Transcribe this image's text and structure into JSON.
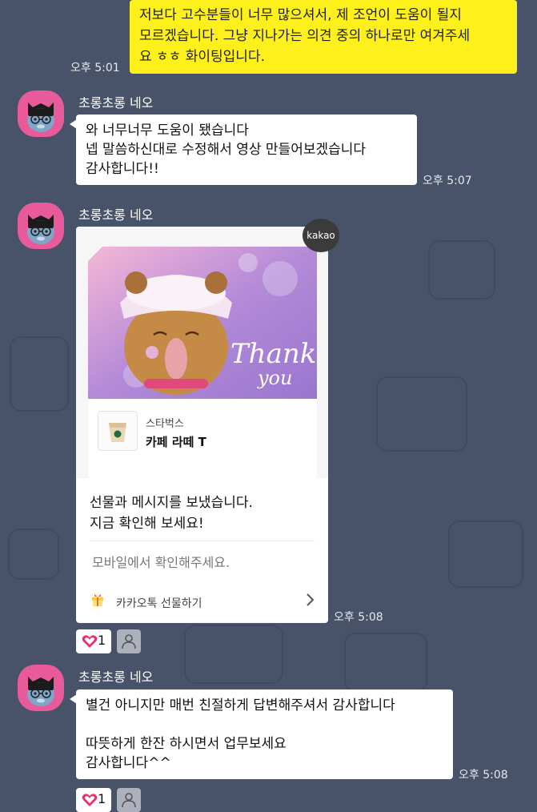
{
  "my_message": {
    "lines": [
      "저보다 고수분들이 너무 많으셔서, 제 조언이 도움이 될지",
      "모르겠습니다. 그냥 지나가는 의견 중의 하나로만 여겨주세",
      "요 ㅎㅎ 화이팅입니다."
    ],
    "time": "오후 5:01"
  },
  "sender": {
    "name": "초롱초롱 네오"
  },
  "message1": {
    "lines": [
      "와 너무너무 도움이 됐습니다",
      "넵 말씀하신대로 수정해서 영상 만들어보겠습니다",
      "감사합니다!!"
    ],
    "time": "오후 5:07"
  },
  "gift_card": {
    "badge": "kakao",
    "image_text_1": "Thank",
    "image_text_2": "you",
    "brand": "스타벅스",
    "product": "카페 라떼 T",
    "message_lines": [
      "선물과 메시지를 보냈습니다.",
      "지금 확인해 보세요!"
    ],
    "note": "모바일에서 확인해주세요.",
    "link_label": "카카오톡 선물하기",
    "time": "오후 5:08",
    "like_count": "1"
  },
  "message3": {
    "lines": [
      "별건 아니지만 매번 친절하게 답변해주셔서 감사합니다",
      "",
      "따뜻하게 한잔 하시면서 업무보세요",
      "감사합니다^^"
    ],
    "time": "오후 5:08",
    "like_count": "1"
  },
  "colors": {
    "background": "#48536a",
    "my_bubble": "#fef01b",
    "avatar": "#e95a9b",
    "like_heart": "#e8316f"
  }
}
